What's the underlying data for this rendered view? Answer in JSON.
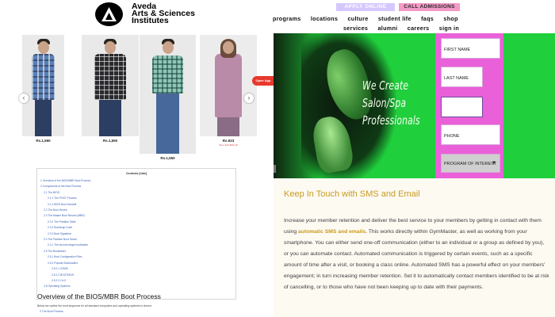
{
  "header": {
    "logo_line1": "Aveda",
    "logo_line2": "Arts & Sciences",
    "logo_line3": "Institutes",
    "apply_label": "APPLY ONLINE",
    "call_label": "CALL ADMISSIONS",
    "nav_row1": [
      "programs",
      "locations",
      "culture",
      "student life",
      "faqs",
      "shop"
    ],
    "nav_row2": [
      "services",
      "alumni",
      "careers",
      "sign in"
    ],
    "colors": {
      "apply_bg": "#d5c7ff",
      "call_bg": "#f49ac6"
    }
  },
  "products": {
    "items": [
      {
        "price": "Rs.1,550",
        "subprice": ""
      },
      {
        "price": "Rs.1,550",
        "subprice": ""
      },
      {
        "price": "Rs.1,550",
        "subprice": ""
      },
      {
        "price": "Rs.923",
        "subprice": "Rs.1,319 30% off"
      }
    ],
    "prev_arrow": "‹",
    "next_arrow": "›",
    "open_app": "Open App"
  },
  "toc": {
    "title": "Contents [hide]",
    "items": [
      "1 Overview of the BIOS/MBR Boot Process",
      "2 Components of the Boot Process",
      "2.1 The BIOS",
      "2.1.1 The POST Process",
      "2.1.2 BIOS Boot Handoff",
      "2.2 The Boot Device",
      "2.3 The Master Boot Record (MBR)",
      "2.3.1 The Partition Table",
      "2.3.2 Bootstrap Code",
      "2.3.3 Boot Signature",
      "2.4 The Partition Boot Sector",
      "2.4.1 The second-stage bootloader",
      "2.5 The Bootloader",
      "2.5.1 Boot Configuration Files",
      "2.5.2 Popular Bootloaders",
      "2.5.2.1 GRUB",
      "2.5.2.2 BOOTMGR",
      "2.5.2.3 LILO",
      "2.6 Operating Systems",
      "3 The Boot Process"
    ]
  },
  "article": {
    "heading": "Overview of the BIOS/MBR Boot Process",
    "snippet": "Below we outline the boot sequence for all standard computers and operating systems is shown:",
    "more": "1 The Boot Process"
  },
  "hero": {
    "tagline": [
      "We Create",
      "Salon/Spa",
      "Professionals"
    ],
    "colors": {
      "green": "#1fcf3c",
      "form_pink": "#e960d9"
    }
  },
  "form": {
    "first_name": "FIRST NAME",
    "last_name": "LAST NAME",
    "email_value": "",
    "phone": "PHONE",
    "program": "PROGRAM OF INTEREST",
    "caret": "▼"
  },
  "sms": {
    "heading": "Keep In Touch with SMS and Email",
    "p_before": "Increase your member retention and deliver the best service to your members by getting in contact with them using ",
    "p_link": "automatic SMS and emails",
    "p_after": ". This works directly within GymMaster, as well as working from your smartphone. You can either send one-off communication (either to an individual or a group as defined by you), or you can automate contact. Automated communication is triggered by certain events, such as a specific amount of time after a visit, or booking a class online. Automated SMS has a powerful effect on your members' engagement; in turn increasing member retention. Set it to automatically contact members identified to be at risk of cancelling, or to those who have not been keeping up to date with their payments.",
    "colors": {
      "heading": "#c79a22"
    }
  }
}
